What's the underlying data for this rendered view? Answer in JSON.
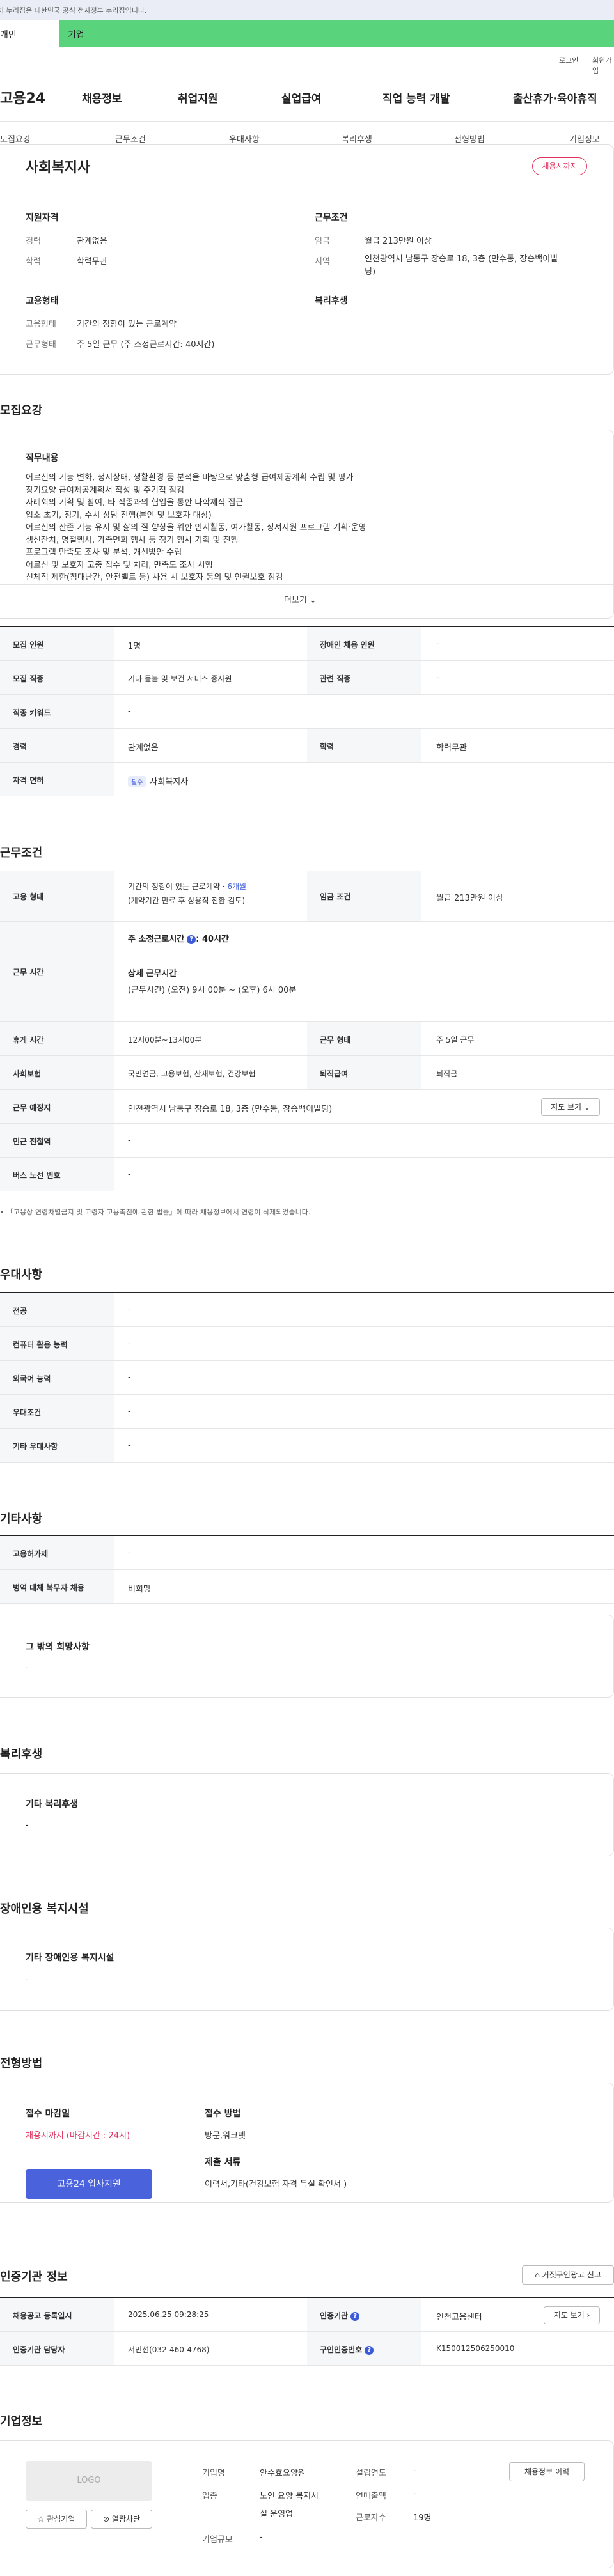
{
  "gov_banner": "이 누리집은 대한민국 공식 전자정부 누리집입니다.",
  "top_tabs": [
    "개인",
    "기업"
  ],
  "util_links": [
    "로그인",
    "회원가입"
  ],
  "logo": "고용24",
  "gnb": [
    "채용정보",
    "취업지원",
    "실업급여",
    "직업 능력 개발",
    "출산휴가·육아휴직"
  ],
  "section_nav": [
    "모집요강",
    "근무조건",
    "우대사항",
    "복리후생",
    "전형방법",
    "기업정보"
  ],
  "summary": {
    "title": "사회복지사",
    "badge": "채용시까지",
    "qual_heading": "지원자격",
    "cond_heading": "근무조건",
    "emp_heading": "고용형태",
    "welfare_heading": "복리후생",
    "career_label": "경력",
    "career_value": "관계없음",
    "edu_label": "학력",
    "edu_value": "학력무관",
    "wage_label": "임금",
    "wage_value": "월급 213만원 이상",
    "region_label": "지역",
    "region_value_1": "인천광역시 남동구 장승로 18, 3층 (만수동, 장승백이빌",
    "region_value_2": "딩)",
    "emptype_label": "고용형태",
    "emptype_value": "기간의 정함이 있는 근로계약",
    "worktype_label": "근무형태",
    "worktype_value": "주 5일 근무 (주 소정근로시간: 40시간)"
  },
  "recruit": {
    "heading": "모집요강",
    "job_heading": "직무내용",
    "job_lines": [
      "어르신의 기능 변화, 정서상태, 생활환경 등 분석을 바탕으로 맞춤형 급여제공계획 수립 및 평가",
      "장기요양 급여제공계획서 작성 및 주기적 점검",
      "사례회의 기획 및 참여, 타 직종과의 협업을 통한 다학제적 접근",
      "입소 초기, 정기, 수시 상담 진행(본인 및 보호자 대상)",
      "어르신의 잔존 기능 유지 및 삶의 질 향상을 위한 인지활동, 여가활동, 정서지원 프로그램 기획·운영",
      "생신잔치, 명절행사, 가족면회 행사 등 정기 행사 기획 및 진행",
      "프로그램 만족도 조사 및 분석, 개선방안 수립",
      "어르신 및 보호자 고충 접수 및 처리, 만족도 조사 시행",
      "신체적 제한(침대난간, 안전벨트 등) 사용 시 보호자 동의 및 인권보호 점검"
    ],
    "more": "더보기",
    "rows": [
      {
        "l1": "모집 인원",
        "v1": "1명",
        "l2": "장애인 채용 인원",
        "v2": "-"
      },
      {
        "l1": "모집 직종",
        "v1": "기타 돌봄 및 보건 서비스 종사원",
        "l2": "관련 직종",
        "v2": "-"
      },
      {
        "l1": "직종 키워드",
        "v1": "-",
        "l2": "",
        "v2": ""
      },
      {
        "l1": "경력",
        "v1": "관계없음",
        "l2": "학력",
        "v2": "학력무관"
      },
      {
        "l1": "자격 면허",
        "v1": "사회복지사",
        "l2": "",
        "v2": ""
      }
    ],
    "license_pill": "필수"
  },
  "conditions": {
    "heading": "근무조건",
    "emp_label": "고용 형태",
    "emp_value_1": "기간의 정함이 있는 근로계약 · ",
    "emp_highlight": "6개월",
    "emp_value_2": "(계약기간 만료 후 상용직 전환 검토)",
    "wage_label": "임금 조건",
    "wage_value": "월급 213만원 이상",
    "time_label": "근무 시간",
    "weekly_hours": "주 소정근로시간",
    "weekly_hours_val": ": 40시간",
    "detail_title": "상세 근무시간",
    "detail_value": "(근무시간) (오전) 9시 00분 ~ (오후) 6시 00분",
    "rest_label": "휴게 시간",
    "rest_value": "12시00분~13시00분",
    "form_label": "근무 형태",
    "form_value": "주 5일 근무",
    "ins_label": "사회보험",
    "ins_value": "국민연금, 고용보험, 산재보험, 건강보험",
    "sev_label": "퇴직급여",
    "sev_value": "퇴직금",
    "addr_label": "근무 예정지",
    "addr_value": "인천광역시 남동구 장승로 18, 3층 (만수동, 장승백이빌딩)",
    "map_btn": "지도 보기",
    "station_label": "인근 전철역",
    "station_value": "-",
    "bus_label": "버스 노선 번호",
    "bus_value": "-",
    "note": "「고용상 연령차별금지 및 고령자 고용촉진에 관한 법률」에 따라 채용정보에서 연령이 삭제되었습니다."
  },
  "preference": {
    "heading": "우대사항",
    "rows": [
      {
        "l": "전공",
        "v": "-"
      },
      {
        "l": "컴퓨터 활용 능력",
        "v": "-"
      },
      {
        "l": "외국어 능력",
        "v": "-"
      },
      {
        "l": "우대조건",
        "v": "-"
      },
      {
        "l": "기타 우대사항",
        "v": "-"
      }
    ]
  },
  "other": {
    "heading": "기타사항",
    "rows": [
      {
        "l": "고용허가제",
        "v": "-"
      },
      {
        "l": "병역 대체 복무자 채용",
        "v": "비희망"
      }
    ],
    "box_title": "그 밖의 희망사항",
    "box_value": "-"
  },
  "welfare": {
    "heading": "복리후생",
    "box_title": "기타 복리후생",
    "box_value": "-"
  },
  "disability": {
    "heading": "장애인용 복지시설",
    "box_title": "기타 장애인용 복지시설",
    "box_value": "-"
  },
  "process": {
    "heading": "전형방법",
    "deadline_label": "접수 마감일",
    "deadline_value": "채용시까지 (마감시간 : 24시)",
    "apply_btn": "고용24 입사지원",
    "method_label": "접수 방법",
    "method_value": "방문,워크넷",
    "docs_label": "제출 서류",
    "docs_value": "이력서,기타(건강보험 자격 득실 확인서 )"
  },
  "agency": {
    "heading": "인증기관 정보",
    "report_btn": "거짓구인광고 신고",
    "r1_l1": "채용공고 등록일시",
    "r1_v1": "2025.06.25 09:28:25",
    "r1_l2": "인증기관",
    "r1_v2": "인천고용센터",
    "map_btn": "지도 보기",
    "r2_l1": "인증기관 담당자",
    "r2_v1": "서민선(032-460-4768)",
    "r2_l2": "구인인증번호",
    "r2_v2": "K150012506250010"
  },
  "company": {
    "heading": "기업정보",
    "logo_text": "LOGO",
    "interest_btn": "관심기업",
    "block_btn": "열람차단",
    "name_label": "기업명",
    "name_value": "안수효요양원",
    "year_label": "설립연도",
    "year_value": "-",
    "history_btn": "채용정보 이력",
    "industry_label": "업종",
    "industry_value_1": "노인 요양 복지시",
    "industry_value_2": "설 운영업",
    "sales_label": "연매출액",
    "sales_value": "-",
    "workers_label": "근로자수",
    "workers_value": "19명",
    "size_label": "기업규모",
    "size_value": "-"
  },
  "colors": {
    "accent_green": "#5ad47c",
    "accent_blue": "#4a62dc",
    "accent_red": "#e0325f"
  }
}
